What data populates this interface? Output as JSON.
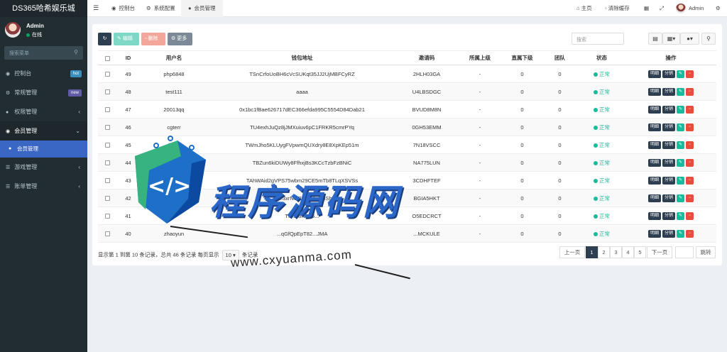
{
  "app": {
    "brand": "DS365哈希娱乐城"
  },
  "user": {
    "name": "Admin",
    "status": "在线"
  },
  "sidebar": {
    "search_placeholder": "搜索菜单",
    "items": [
      {
        "label": "控制台",
        "badge": "hot",
        "badge_color": "#3c8dbc"
      },
      {
        "label": "常规管理",
        "badge": "new",
        "badge_color": "#605ca8"
      },
      {
        "label": "权限管理"
      },
      {
        "label": "会员管理",
        "sub": [
          {
            "label": "会员管理"
          }
        ]
      },
      {
        "label": "游戏管理"
      },
      {
        "label": "账单管理"
      }
    ]
  },
  "topbar": {
    "tabs": [
      {
        "label": "控制台"
      },
      {
        "label": "系统配置"
      },
      {
        "label": "会员管理"
      }
    ],
    "home": "主页",
    "clear_cache": "清除缓存",
    "user": "Admin"
  },
  "toolbar": {
    "edit": "编辑",
    "delete": "删除",
    "more": "更多",
    "search_placeholder": "搜索"
  },
  "table": {
    "headers": [
      "ID",
      "用户名",
      "钱包地址",
      "邀请码",
      "所属上级",
      "直属下级",
      "团队",
      "状态",
      "操作"
    ],
    "rows": [
      {
        "id": "49",
        "user": "php6848",
        "wallet": "TSnCrfoUoBH6cVcSUKqt35JJ2UjMBFCyRZ",
        "code": "2HLH03GA",
        "parent": "-",
        "direct": "0",
        "team": "0",
        "status": "正常"
      },
      {
        "id": "48",
        "user": "test111",
        "wallet": "aaaa",
        "code": "U4LBSDGC",
        "parent": "-",
        "direct": "0",
        "team": "0",
        "status": "正常"
      },
      {
        "id": "47",
        "user": "20013qq",
        "wallet": "0x1bc1fBae626717dEC366efda995C5554D84Dab21",
        "code": "BVUD8M8N",
        "parent": "-",
        "direct": "0",
        "team": "0",
        "status": "正常"
      },
      {
        "id": "46",
        "user": "cgterr",
        "wallet": "TU4exhJuQz8jJMXuiuv6pC1FRKR5cmrPYq",
        "code": "0GH53EMM",
        "parent": "-",
        "direct": "0",
        "team": "0",
        "status": "正常"
      },
      {
        "id": "45",
        "user": "liuo0",
        "wallet": "TWmJho5KLUygFVpwmQUXdry8E8XpKEp51m",
        "code": "7N18VSCC",
        "parent": "-",
        "direct": "0",
        "team": "0",
        "status": "正常"
      },
      {
        "id": "44",
        "user": "",
        "wallet": "TBZun6kiDUWy8FfhxjBs3KCcTzbFzBNiC",
        "code": "NA775LUN",
        "parent": "-",
        "direct": "0",
        "team": "0",
        "status": "正常"
      },
      {
        "id": "43",
        "user": "",
        "wallet": "TAhWAid2gVPS75wbm29CE5mTb8TLqXSVSs",
        "code": "3CDHFTEF",
        "parent": "-",
        "direct": "0",
        "team": "0",
        "status": "正常"
      },
      {
        "id": "42",
        "user": "",
        "wallet": "TF...3xrNGBTunYLi6MSh",
        "code": "BGIA5HKT",
        "parent": "-",
        "direct": "0",
        "team": "0",
        "status": "正常"
      },
      {
        "id": "41",
        "user": "",
        "wallet": "TP...53h...75...",
        "code": "O5EDCRCT",
        "parent": "-",
        "direct": "0",
        "team": "0",
        "status": "正常"
      },
      {
        "id": "40",
        "user": "zhaoyun",
        "wallet": "...qGfQpEpT82...JMA",
        "code": "...MCKULE",
        "parent": "-",
        "direct": "0",
        "team": "0",
        "status": "正常"
      }
    ],
    "actions": {
      "detail": "明细",
      "split": "分销"
    }
  },
  "footer": {
    "summary": "显示第 1 到第 10 条记录，总共 46 条记录 每页显示",
    "page_size": "10",
    "suffix": "条记录"
  },
  "pager": {
    "prev": "上一页",
    "pages": [
      "1",
      "2",
      "3",
      "4",
      "5"
    ],
    "next": "下一页",
    "jump": "跳转"
  },
  "watermark": {
    "title": "程序源码网",
    "url": "www.cxyuanma.com"
  }
}
